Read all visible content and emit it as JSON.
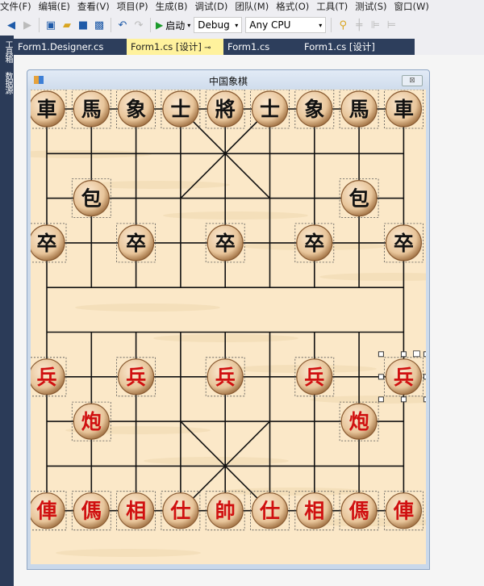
{
  "menu": [
    "文件(F)",
    "编辑(E)",
    "查看(V)",
    "项目(P)",
    "生成(B)",
    "调试(D)",
    "团队(M)",
    "格式(O)",
    "工具(T)",
    "测试(S)",
    "窗口(W)"
  ],
  "toolbar": {
    "start_label": "启动",
    "config": "Debug",
    "platform": "Any CPU"
  },
  "leftbar": [
    "工具箱",
    "数据源"
  ],
  "tabs": [
    {
      "label": "Form1.Designer.cs",
      "active": false
    },
    {
      "label": "Form1.cs [设计]",
      "active": true
    },
    {
      "label": "Form1.cs",
      "active": false
    },
    {
      "label": "Form1.cs [设计]",
      "active": false
    }
  ],
  "form": {
    "title": "中国象棋",
    "close": "⊠"
  },
  "colors": {
    "black_piece": "#111111",
    "red_piece": "#d01010",
    "board": "#fbe8c8",
    "tab_strip": "#2d3e5c",
    "active_tab": "#fff29d"
  },
  "pieces": [
    {
      "c": "車",
      "col": 0,
      "row": 0,
      "side": "black"
    },
    {
      "c": "馬",
      "col": 1,
      "row": 0,
      "side": "black"
    },
    {
      "c": "象",
      "col": 2,
      "row": 0,
      "side": "black"
    },
    {
      "c": "士",
      "col": 3,
      "row": 0,
      "side": "black"
    },
    {
      "c": "將",
      "col": 4,
      "row": 0,
      "side": "black"
    },
    {
      "c": "士",
      "col": 5,
      "row": 0,
      "side": "black"
    },
    {
      "c": "象",
      "col": 6,
      "row": 0,
      "side": "black"
    },
    {
      "c": "馬",
      "col": 7,
      "row": 0,
      "side": "black"
    },
    {
      "c": "車",
      "col": 8,
      "row": 0,
      "side": "black"
    },
    {
      "c": "包",
      "col": 1,
      "row": 2,
      "side": "black"
    },
    {
      "c": "包",
      "col": 7,
      "row": 2,
      "side": "black"
    },
    {
      "c": "卒",
      "col": 0,
      "row": 3,
      "side": "black"
    },
    {
      "c": "卒",
      "col": 2,
      "row": 3,
      "side": "black"
    },
    {
      "c": "卒",
      "col": 4,
      "row": 3,
      "side": "black"
    },
    {
      "c": "卒",
      "col": 6,
      "row": 3,
      "side": "black"
    },
    {
      "c": "卒",
      "col": 8,
      "row": 3,
      "side": "black"
    },
    {
      "c": "兵",
      "col": 0,
      "row": 6,
      "side": "red"
    },
    {
      "c": "兵",
      "col": 2,
      "row": 6,
      "side": "red"
    },
    {
      "c": "兵",
      "col": 4,
      "row": 6,
      "side": "red"
    },
    {
      "c": "兵",
      "col": 6,
      "row": 6,
      "side": "red"
    },
    {
      "c": "兵",
      "col": 8,
      "row": 6,
      "side": "red",
      "selected": true
    },
    {
      "c": "炮",
      "col": 1,
      "row": 7,
      "side": "red"
    },
    {
      "c": "炮",
      "col": 7,
      "row": 7,
      "side": "red"
    },
    {
      "c": "俥",
      "col": 0,
      "row": 9,
      "side": "red"
    },
    {
      "c": "傌",
      "col": 1,
      "row": 9,
      "side": "red"
    },
    {
      "c": "相",
      "col": 2,
      "row": 9,
      "side": "red"
    },
    {
      "c": "仕",
      "col": 3,
      "row": 9,
      "side": "red"
    },
    {
      "c": "帥",
      "col": 4,
      "row": 9,
      "side": "red"
    },
    {
      "c": "仕",
      "col": 5,
      "row": 9,
      "side": "red"
    },
    {
      "c": "相",
      "col": 6,
      "row": 9,
      "side": "red"
    },
    {
      "c": "傌",
      "col": 7,
      "row": 9,
      "side": "red"
    },
    {
      "c": "俥",
      "col": 8,
      "row": 9,
      "side": "red"
    }
  ]
}
